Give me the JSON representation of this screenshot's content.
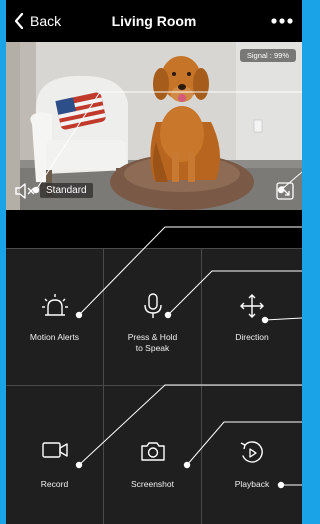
{
  "header": {
    "back_label": "Back",
    "title": "Living Room",
    "more_icon": "more-dots-icon"
  },
  "video": {
    "signal_label": "Signal : 99%",
    "quality_label": "Standard",
    "mute_icon": "speaker-muted-icon",
    "fullscreen_icon": "fullscreen-icon"
  },
  "controls": [
    {
      "label": "Motion Alerts",
      "icon": "alarm-icon"
    },
    {
      "label": "Press & Hold\nto Speak",
      "icon": "microphone-icon"
    },
    {
      "label": "Direction",
      "icon": "move-arrows-icon"
    },
    {
      "label": "Record",
      "icon": "video-camera-icon"
    },
    {
      "label": "Screenshot",
      "icon": "camera-icon"
    },
    {
      "label": "Playback",
      "icon": "playback-icon"
    }
  ]
}
